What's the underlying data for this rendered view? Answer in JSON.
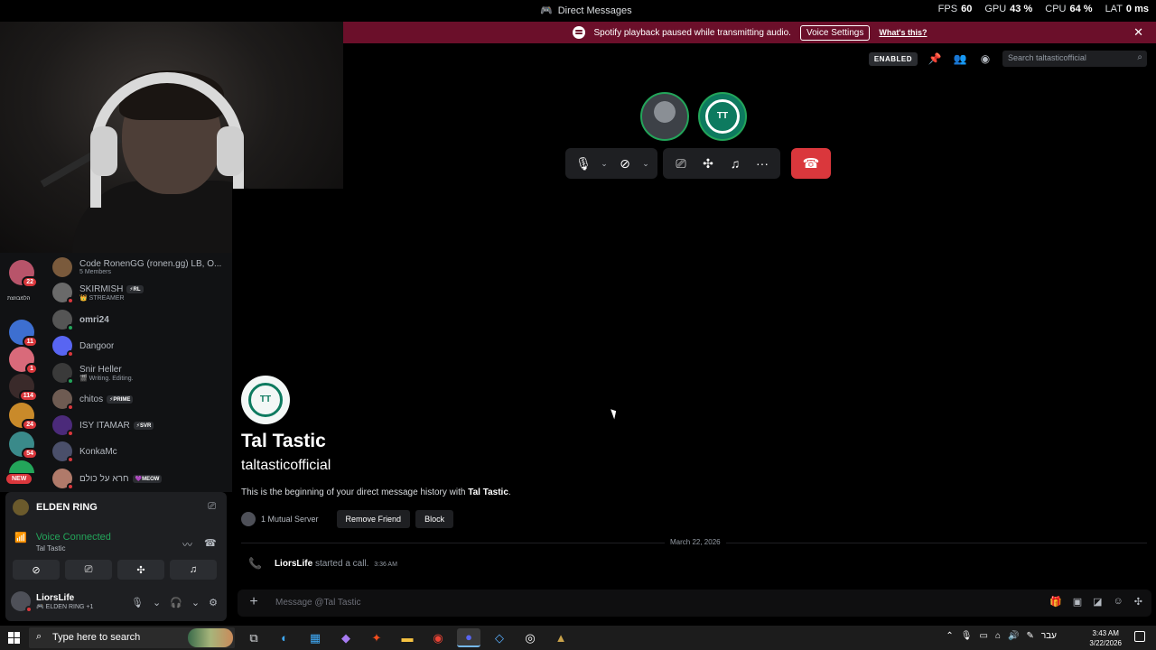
{
  "titlebar": {
    "title": "Direct Messages",
    "stats": [
      {
        "label": "FPS",
        "value": "60"
      },
      {
        "label": "GPU",
        "value": "43 %"
      },
      {
        "label": "CPU",
        "value": "64 %"
      },
      {
        "label": "LAT",
        "value": "0 ms"
      }
    ]
  },
  "notice": {
    "text": "Spotify playback paused while transmitting audio.",
    "button": "Voice Settings",
    "link": "What's this?",
    "close": "✕"
  },
  "header": {
    "badge": "ENABLED",
    "search_placeholder": "Search taltasticofficial"
  },
  "call": {
    "participant2_logo": "TT"
  },
  "profile": {
    "logo": "TT",
    "display_name": "Tal Tastic",
    "username": "taltasticofficial",
    "description_prefix": "This is the beginning of your direct message history with ",
    "description_name": "Tal Tastic",
    "description_suffix": ".",
    "mutual": "1 Mutual Server",
    "remove_friend": "Remove Friend",
    "block": "Block"
  },
  "history": {
    "date_divider": "March 22, 2026",
    "call_user": "LiorsLife",
    "call_action": "started a call.",
    "call_time": "3:36 AM"
  },
  "composer": {
    "placeholder": "Message @Tal Tastic"
  },
  "rail": {
    "badges": [
      "22",
      "11",
      "1",
      "114",
      "24",
      "54"
    ],
    "text_item": "הלמבוזצת",
    "new_label": "NEW"
  },
  "dms": [
    {
      "name": "Code RonenGG (ronen.gg) LB, O...",
      "sub": "5 Members",
      "tag": "",
      "color": "#7a5a3c",
      "status": ""
    },
    {
      "name": "SKIRMISH",
      "sub": "👑 STREAMER",
      "tag": "⚡RL",
      "color": "#6a6a6a",
      "status": "#da373c"
    },
    {
      "name": "omri24",
      "sub": "",
      "tag": "",
      "color": "#555555",
      "status": "#23a55a",
      "bold": true
    },
    {
      "name": "Dangoor",
      "sub": "",
      "tag": "",
      "color": "#5865f2",
      "status": "#da373c"
    },
    {
      "name": "Snir Heller",
      "sub": "🎬 Writing. Editing.",
      "tag": "",
      "color": "#3a3a3a",
      "status": "#23a55a"
    },
    {
      "name": "chitos",
      "sub": "",
      "tag": "⚡PRIME",
      "color": "#6e5b52",
      "status": "#da373c"
    },
    {
      "name": "ISY ITAMAR",
      "sub": "",
      "tag": "⚡SVR",
      "color": "#4b2a7a",
      "status": "#da373c"
    },
    {
      "name": "KonkaMc",
      "sub": "",
      "tag": "",
      "color": "#4a4f6a",
      "status": "#da373c"
    },
    {
      "name": "חרא על כולם",
      "sub": "",
      "tag": "💜MEOW",
      "color": "#b07a6a",
      "status": "#da373c"
    }
  ],
  "panel": {
    "game": "ELDEN RING",
    "voice_status": "Voice Connected",
    "voice_channel": "Tal Tastic",
    "username": "LiorsLife",
    "user_sub": "🎮 ELDEN RING +1"
  },
  "taskbar": {
    "search_placeholder": "Type here to search",
    "language": "עבר",
    "time": "3:43 AM",
    "date": "3/22/2026"
  }
}
